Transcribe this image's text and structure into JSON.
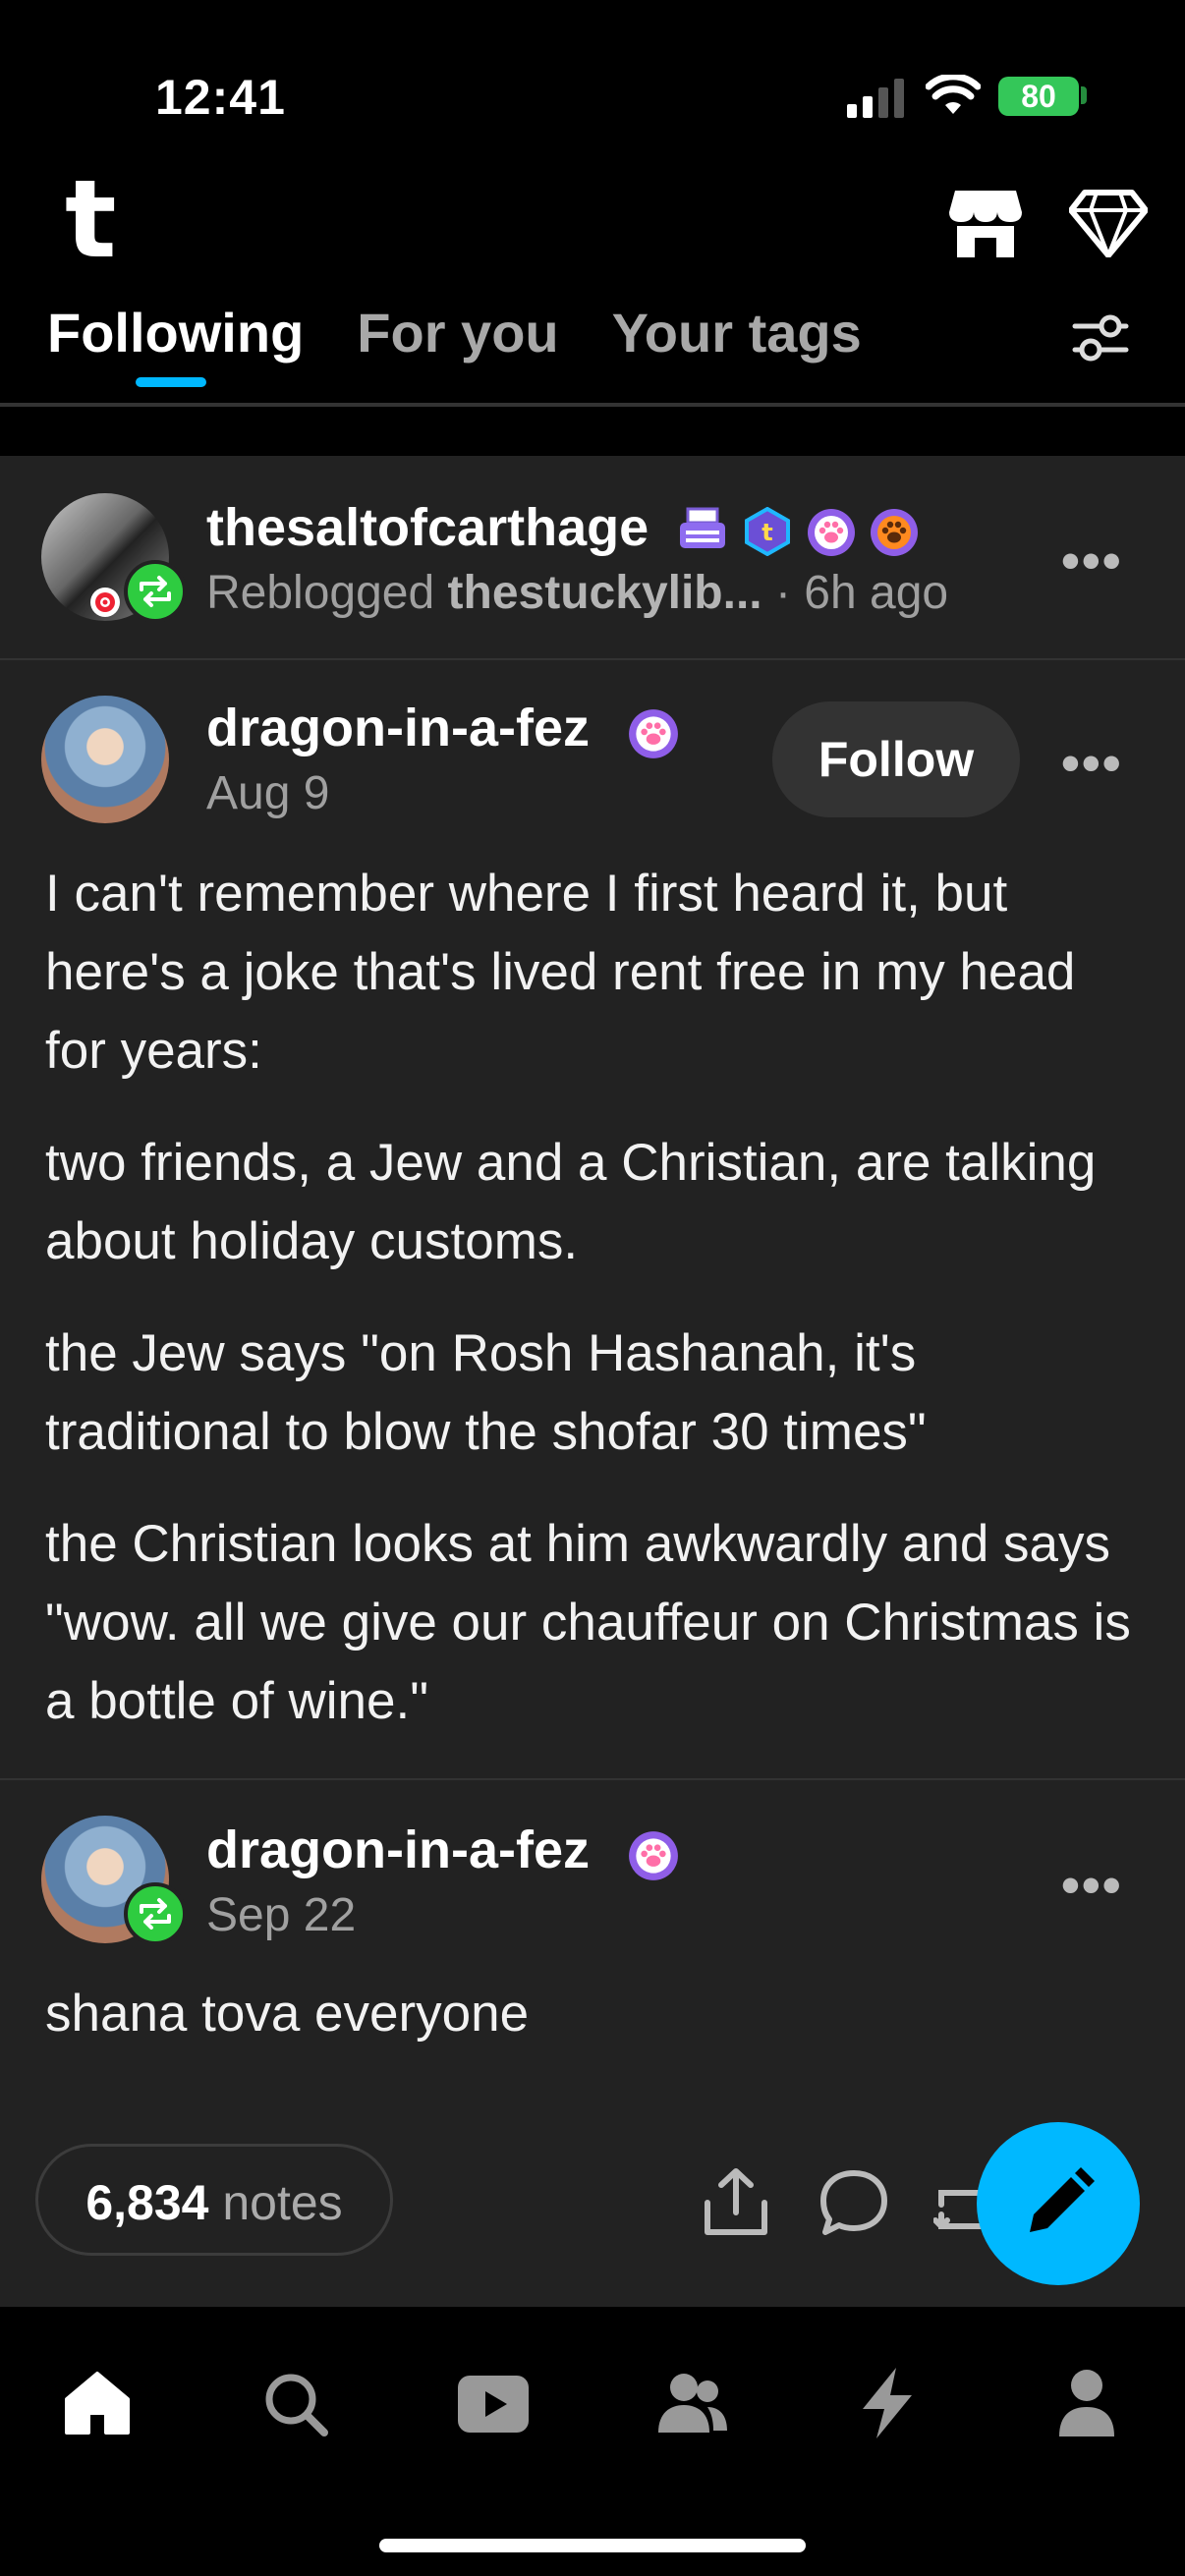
{
  "status_bar": {
    "time": "12:41",
    "battery": "80"
  },
  "header": {
    "tabs": [
      {
        "label": "Following"
      },
      {
        "label": "For you"
      },
      {
        "label": "Your tags"
      }
    ]
  },
  "reblog_header": {
    "username": "thesaltofcarthage",
    "reblogged_label": "Reblogged",
    "source": "thestuckylib...",
    "time": "· 6h ago"
  },
  "post": {
    "username": "dragon-in-a-fez",
    "date": "Aug 9",
    "follow_label": "Follow",
    "paragraphs": [
      "I can't remember where I first heard it, but here's a joke that's lived rent free in my head for years:",
      "two friends, a Jew and a Christian, are talking about holiday customs.",
      "the Jew says \"on Rosh Hashanah, it's traditional to blow the shofar 30 times\"",
      "the Christian looks at him awkwardly and says \"wow. all we give our chauffeur on Christmas is a bottle of wine.\""
    ]
  },
  "reblog": {
    "username": "dragon-in-a-fez",
    "date": "Sep 22",
    "text": "shana tova everyone"
  },
  "footer": {
    "notes_count": "6,834",
    "notes_label": "notes"
  },
  "colors": {
    "accent": "#00b8ff",
    "reblog_green": "#2ecc40",
    "card_bg": "#222222"
  }
}
